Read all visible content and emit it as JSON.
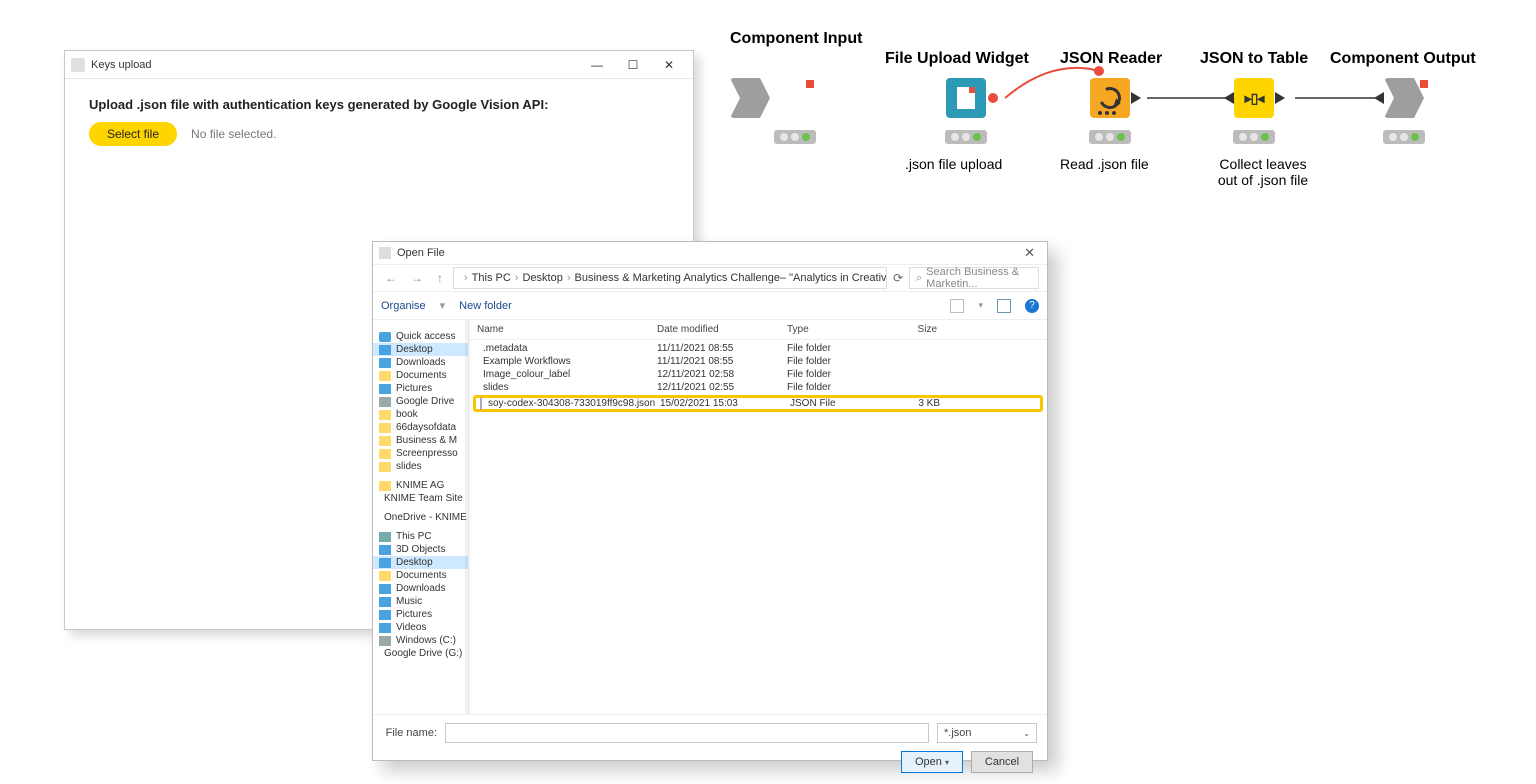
{
  "keys_dialog": {
    "title": "Keys upload",
    "heading": "Upload .json file with authentication keys generated by Google Vision API:",
    "select_btn": "Select file",
    "no_file": "No file selected."
  },
  "open_dialog": {
    "title": "Open File",
    "breadcrumb": [
      "This PC",
      "Desktop",
      "Business & Marketing Analytics Challenge– \"Analytics in Creative Industries\""
    ],
    "search_placeholder": "Search Business & Marketin...",
    "organise": "Organise",
    "new_folder": "New folder",
    "columns": {
      "name": "Name",
      "date": "Date modified",
      "type": "Type",
      "size": "Size"
    },
    "nav_sections": {
      "quick": {
        "label": "Quick access",
        "items": [
          "Desktop",
          "Downloads",
          "Documents",
          "Pictures",
          "Google Drive",
          "book",
          "66daysofdata",
          "Business & M",
          "Screenpresso",
          "slides"
        ]
      },
      "knime": {
        "label": "KNIME AG",
        "items": [
          "KNIME Team Site"
        ]
      },
      "onedrive": {
        "label": "OneDrive - KNIME"
      },
      "thispc": {
        "label": "This PC",
        "items": [
          "3D Objects",
          "Desktop",
          "Documents",
          "Downloads",
          "Music",
          "Pictures",
          "Videos",
          "Windows (C:)",
          "Google Drive (G:)"
        ]
      }
    },
    "rows": [
      {
        "name": ".metadata",
        "date": "11/11/2021 08:55",
        "type": "File folder",
        "size": "",
        "kind": "folder"
      },
      {
        "name": "Example Workflows",
        "date": "11/11/2021 08:55",
        "type": "File folder",
        "size": "",
        "kind": "folder"
      },
      {
        "name": "Image_colour_label",
        "date": "12/11/2021 02:58",
        "type": "File folder",
        "size": "",
        "kind": "folder"
      },
      {
        "name": "slides",
        "date": "12/11/2021 02:55",
        "type": "File folder",
        "size": "",
        "kind": "folder"
      },
      {
        "name": "soy-codex-304308-733019ff9c98.json",
        "date": "15/02/2021 15:03",
        "type": "JSON File",
        "size": "3 KB",
        "kind": "json",
        "highlight": true
      }
    ],
    "file_name_label": "File name:",
    "file_name_value": "",
    "filter": "*.json",
    "open_btn": "Open",
    "cancel_btn": "Cancel"
  },
  "workflow": {
    "nodes": {
      "comp_in": {
        "title": "Component Input",
        "sub": ""
      },
      "file_up": {
        "title": "File Upload Widget",
        "sub": ".json file upload"
      },
      "json_reader": {
        "title": "JSON Reader",
        "sub": "Read .json file"
      },
      "json_table": {
        "title": "JSON to Table",
        "sub": "Collect leaves\nout of .json file"
      },
      "comp_out": {
        "title": "Component Output",
        "sub": ""
      }
    }
  }
}
